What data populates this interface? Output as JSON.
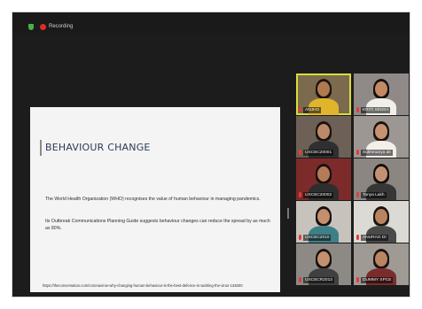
{
  "recording": {
    "label": "Recording"
  },
  "slide": {
    "title": "BEHAVIOUR CHANGE",
    "paragraphs": [
      "The World Health Organization (WHO) recognises the value of human behaviour in managing pandemics.",
      "Its Outbreak Communications Planning Guide suggests behaviour changes can reduce the spread by as much as 80%."
    ],
    "source_url": "https://theconversation.com/coronavirus-why-changing-human-behaviour-is-the-best-defence-in-tackling-the-virus-134500"
  },
  "participants": [
    {
      "name": "ANJHO",
      "active": true
    },
    {
      "name": "KRITI SINGH",
      "active": false
    },
    {
      "name": "",
      "active": false
    },
    {
      "name": "USCBC20001",
      "active": false
    },
    {
      "name": "Sukhmanya ak",
      "active": false
    },
    {
      "name": "",
      "active": false
    },
    {
      "name": "USCBC20002",
      "active": false
    },
    {
      "name": "Tanya Lakh",
      "active": false
    },
    {
      "name": "",
      "active": false
    },
    {
      "name": "USCBC2010",
      "active": false
    },
    {
      "name": "ANURAG DI",
      "active": false
    },
    {
      "name": "SH",
      "active": false
    },
    {
      "name": "USCBCR2013",
      "active": false
    },
    {
      "name": "DUMMY SPCE",
      "active": false
    },
    {
      "name": "",
      "active": false
    }
  ],
  "colors": {
    "window_bg": "#1c1c1c",
    "slide_bg": "#f4f4f4",
    "slide_title": "#2b3b5a",
    "active_border": "#d9dd3a",
    "muted_mic": "#e43b3b",
    "recording_dot": "#e02a2a",
    "security_shield": "#48b14b"
  },
  "icons": {
    "security": "shield-icon",
    "recording": "record-dot-icon",
    "mic": "mic-muted-icon"
  }
}
